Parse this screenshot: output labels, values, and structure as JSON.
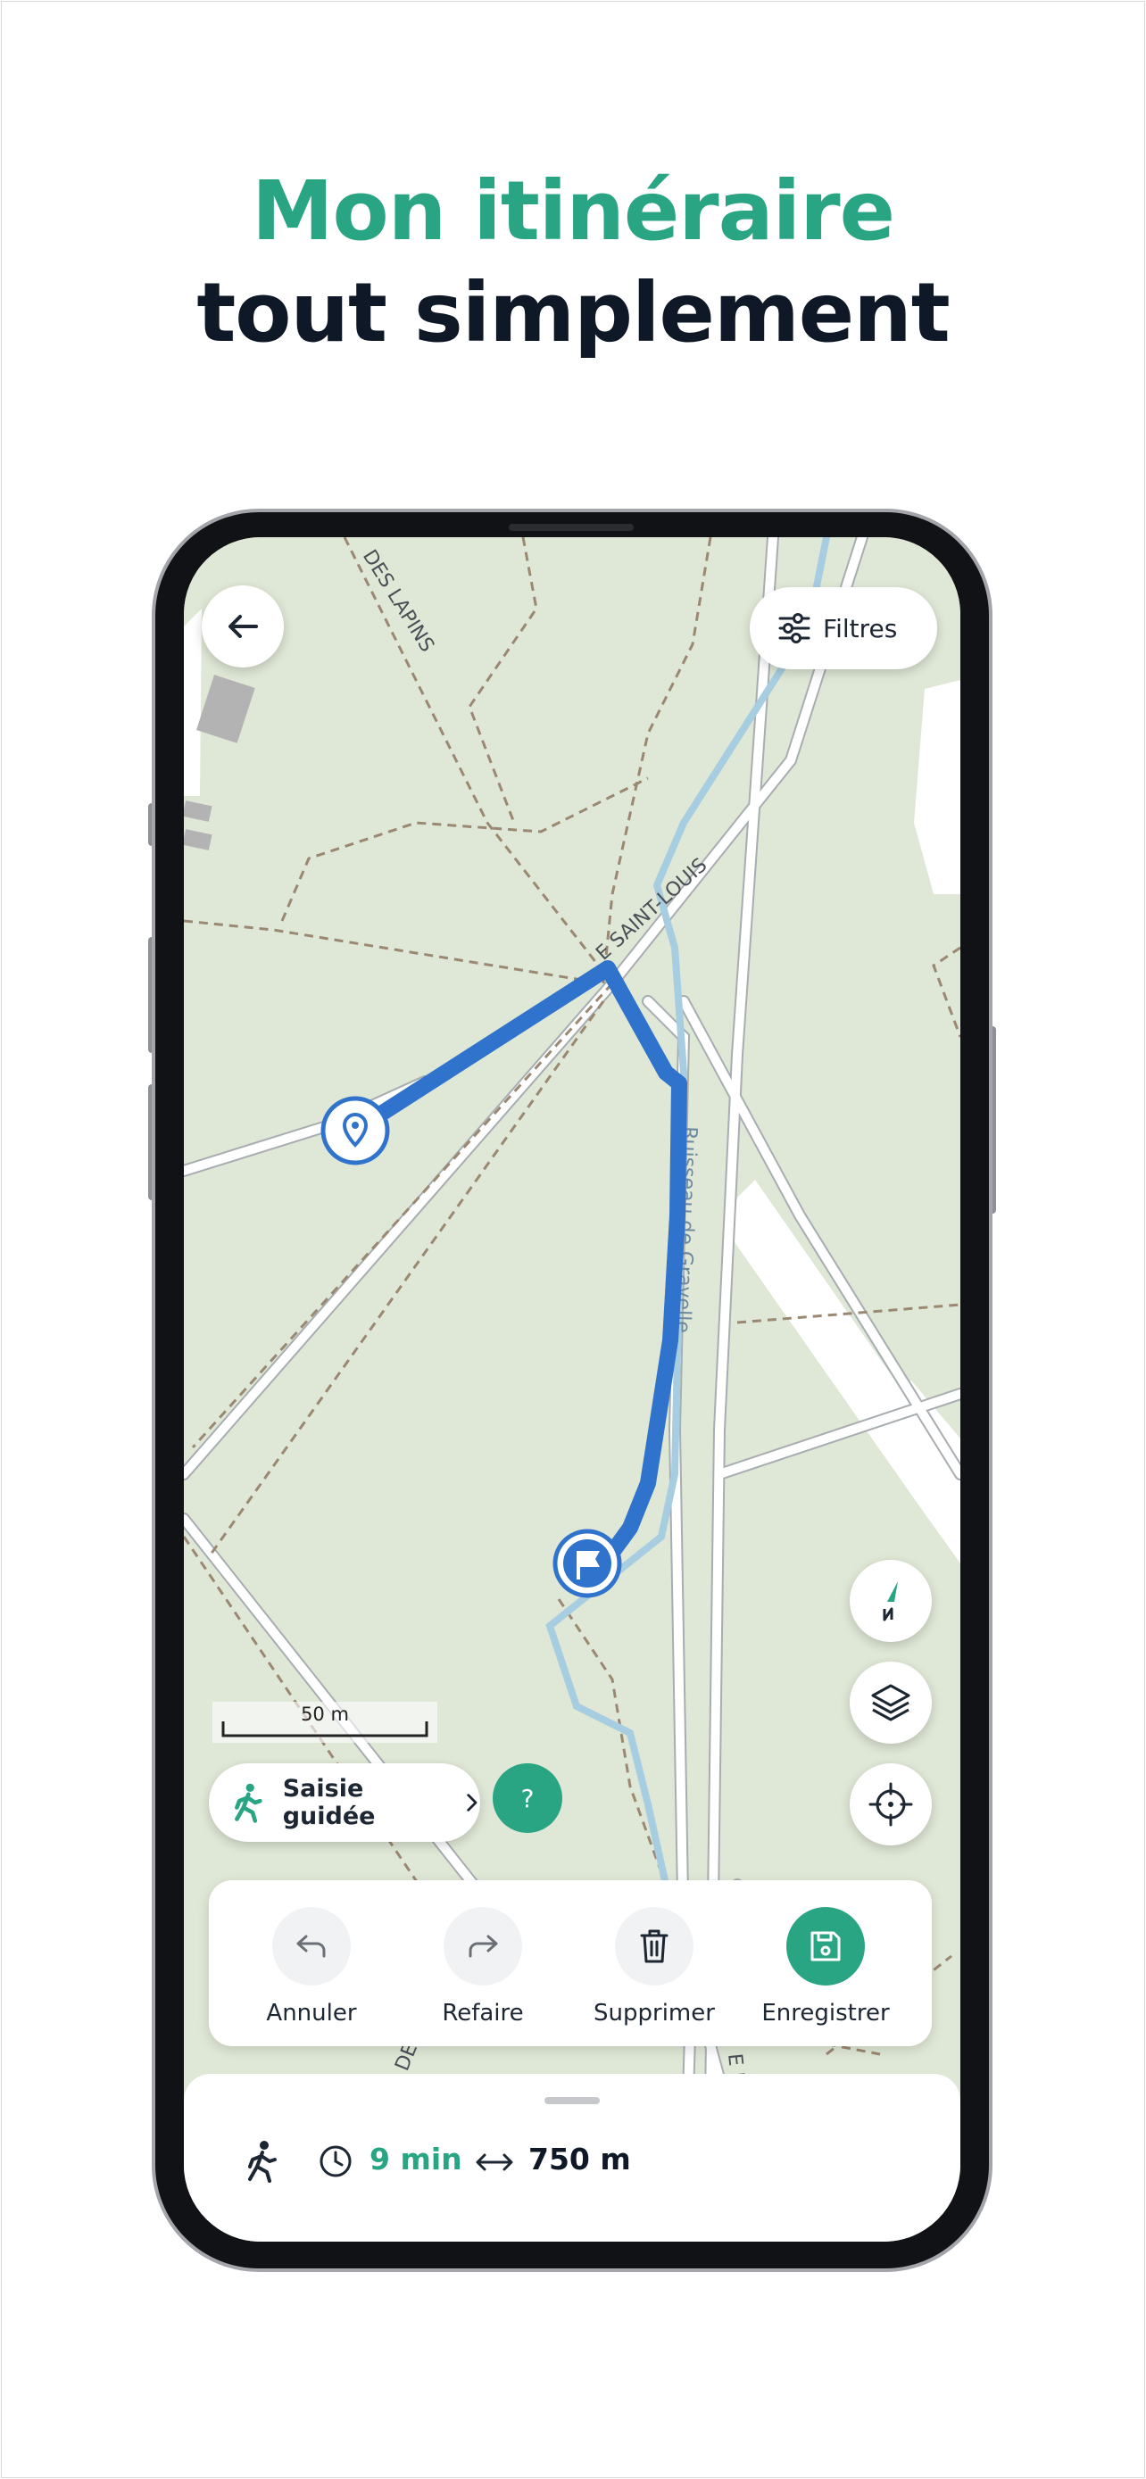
{
  "headline": {
    "line1": "Mon itinéraire",
    "line2": "tout simplement"
  },
  "colors": {
    "brand_green": "#2aa584",
    "route_blue": "#2f73cc",
    "dark_text": "#0f1826",
    "map_bg": "#dfe7d6"
  },
  "map": {
    "street_labels": [
      "DES LAPINS",
      "E SAINT-LOUIS",
      "Ruisseau de Gravelle",
      "DE L",
      "E DE"
    ],
    "scale_label": "50 m",
    "markers": [
      "start-pin-icon",
      "finish-flag-icon"
    ]
  },
  "toolbar": {
    "back_icon": "arrow-left-icon",
    "filters_label": "Filtres",
    "filters_icon": "sliders-icon"
  },
  "map_controls": [
    "compass-icon",
    "layers-icon",
    "locate-icon"
  ],
  "guided": {
    "label": "Saisie guidée",
    "icon": "walking-person-icon",
    "help_label": "?"
  },
  "actions": [
    {
      "label": "Annuler",
      "icon": "undo-icon"
    },
    {
      "label": "Refaire",
      "icon": "redo-icon"
    },
    {
      "label": "Supprimer",
      "icon": "trash-icon"
    },
    {
      "label": "Enregistrer",
      "icon": "save-icon",
      "primary": true
    }
  ],
  "summary": {
    "mode_icon": "walking-person-icon",
    "duration": "9 min",
    "distance": "750 m"
  }
}
